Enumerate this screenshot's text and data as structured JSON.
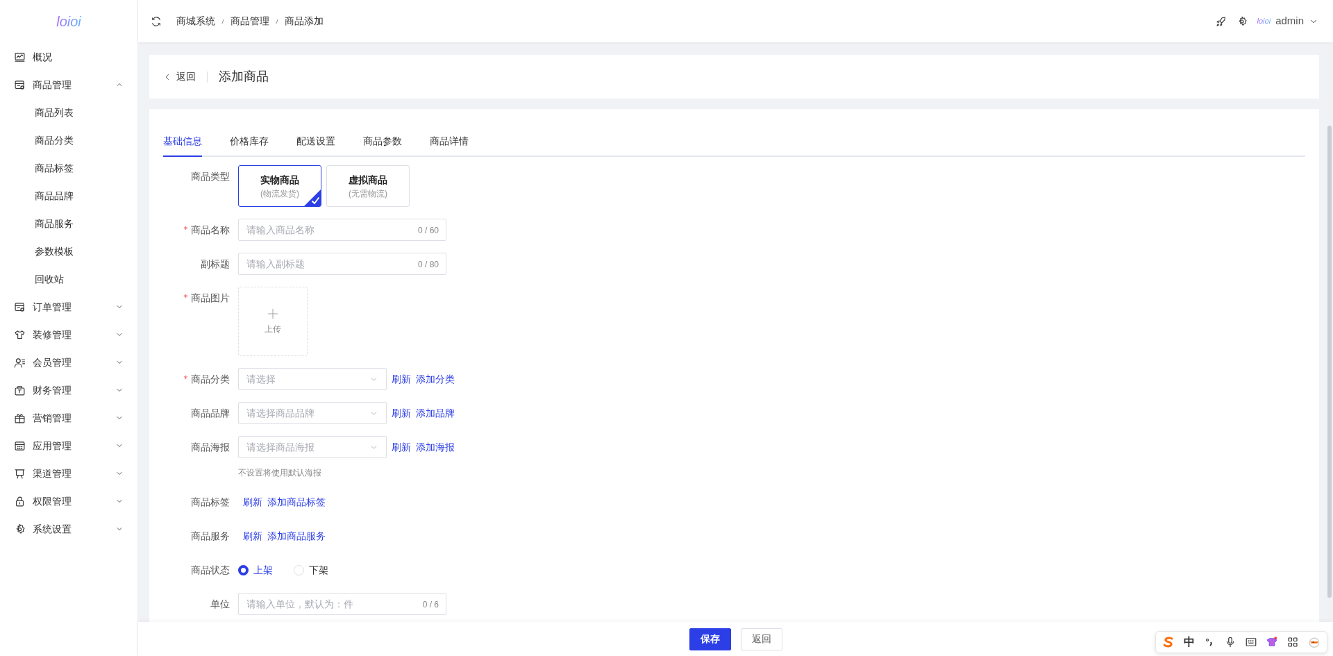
{
  "logo": "loioi",
  "sidebar": {
    "items": [
      {
        "label": "概况"
      },
      {
        "label": "商品管理",
        "expanded": true,
        "children": [
          {
            "label": "商品列表"
          },
          {
            "label": "商品分类"
          },
          {
            "label": "商品标签"
          },
          {
            "label": "商品品牌"
          },
          {
            "label": "商品服务"
          },
          {
            "label": "参数模板"
          },
          {
            "label": "回收站"
          }
        ]
      },
      {
        "label": "订单管理",
        "expanded": false
      },
      {
        "label": "装修管理",
        "expanded": false
      },
      {
        "label": "会员管理",
        "expanded": false
      },
      {
        "label": "财务管理",
        "expanded": false
      },
      {
        "label": "营销管理",
        "expanded": false
      },
      {
        "label": "应用管理",
        "expanded": false
      },
      {
        "label": "渠道管理",
        "expanded": false
      },
      {
        "label": "权限管理",
        "expanded": false
      },
      {
        "label": "系统设置",
        "expanded": false
      }
    ]
  },
  "header": {
    "breadcrumb": [
      "商城系统",
      "商品管理",
      "商品添加"
    ],
    "brand": "loioi",
    "user": "admin"
  },
  "page_header": {
    "back": "返回",
    "title": "添加商品"
  },
  "tabs": [
    {
      "label": "基础信息",
      "selected": true
    },
    {
      "label": "价格库存",
      "selected": false
    },
    {
      "label": "配送设置",
      "selected": false
    },
    {
      "label": "商品参数",
      "selected": false
    },
    {
      "label": "商品详情",
      "selected": false
    }
  ],
  "form": {
    "rows": [
      {
        "kind": "choice",
        "label": "商品类型",
        "required": false,
        "options": [
          {
            "title": "实物商品",
            "subtitle": "(物流发货)",
            "selected": true
          },
          {
            "title": "虚拟商品",
            "subtitle": "(无需物流)",
            "selected": false
          }
        ]
      },
      {
        "kind": "input",
        "label": "商品名称",
        "required": true,
        "placeholder": "请输入商品名称",
        "counter": "0 / 60"
      },
      {
        "kind": "input",
        "label": "副标题",
        "required": false,
        "placeholder": "请输入副标题",
        "counter": "0 / 80"
      },
      {
        "kind": "upload",
        "label": "商品图片",
        "required": true,
        "text": "上传"
      },
      {
        "kind": "select",
        "label": "商品分类",
        "required": true,
        "placeholder": "请选择",
        "links": [
          "刷新",
          "添加分类"
        ]
      },
      {
        "kind": "select",
        "label": "商品品牌",
        "required": false,
        "placeholder": "请选择商品品牌",
        "links": [
          "刷新",
          "添加品牌"
        ]
      },
      {
        "kind": "select",
        "label": "商品海报",
        "required": false,
        "placeholder": "请选择商品海报",
        "links": [
          "刷新",
          "添加海报"
        ],
        "hint": "不设置将使用默认海报"
      },
      {
        "kind": "links",
        "label": "商品标签",
        "required": false,
        "links": [
          "刷新",
          "添加商品标签"
        ]
      },
      {
        "kind": "links",
        "label": "商品服务",
        "required": false,
        "links": [
          "刷新",
          "添加商品服务"
        ]
      },
      {
        "kind": "radio",
        "label": "商品状态",
        "required": false,
        "options": [
          {
            "label": "上架",
            "selected": true
          },
          {
            "label": "下架",
            "selected": false
          }
        ]
      },
      {
        "kind": "input",
        "label": "单位",
        "required": false,
        "placeholder": "请输入单位，默认为：件",
        "counter": "0 / 6"
      }
    ]
  },
  "footer": {
    "buttons": [
      {
        "label": "保存",
        "kind": "primary"
      },
      {
        "label": "返回",
        "kind": "default"
      }
    ]
  },
  "ime": {
    "label": "中"
  }
}
